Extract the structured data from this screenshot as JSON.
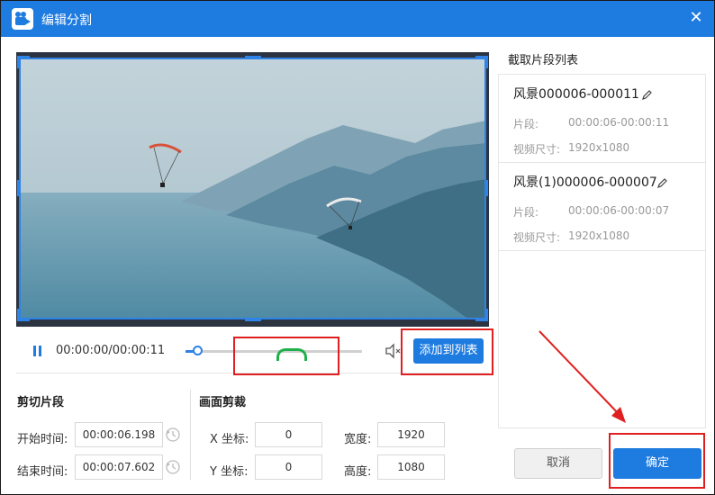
{
  "window": {
    "title": "编辑分割",
    "close_symbol": "✕"
  },
  "player": {
    "time": "00:00:00/00:00:11",
    "add_to_list_label": "添加到列表"
  },
  "cut_segment": {
    "title": "剪切片段",
    "start_label": "开始时间:",
    "start_value": "00:00:06.198",
    "end_label": "结束时间:",
    "end_value": "00:00:07.602"
  },
  "crop": {
    "title": "画面剪裁",
    "x_label": "X 坐标:",
    "x_value": "0",
    "y_label": "Y 坐标:",
    "y_value": "0",
    "width_label": "宽度:",
    "width_value": "1920",
    "height_label": "高度:",
    "height_value": "1080"
  },
  "clip_list": {
    "title": "截取片段列表",
    "items": [
      {
        "name": "风景000006-000011",
        "segment_label": "片段:",
        "segment_value": "00:00:06-00:00:11",
        "size_label": "视频尺寸:",
        "size_value": "1920x1080"
      },
      {
        "name": "风景(1)000006-000007",
        "segment_label": "片段:",
        "segment_value": "00:00:06-00:00:07",
        "size_label": "视频尺寸:",
        "size_value": "1920x1080"
      }
    ]
  },
  "footer": {
    "cancel_label": "取消",
    "ok_label": "确定"
  },
  "colors": {
    "accent": "#1e7be0",
    "highlight": "#e02020",
    "marker": "#20b04a"
  }
}
